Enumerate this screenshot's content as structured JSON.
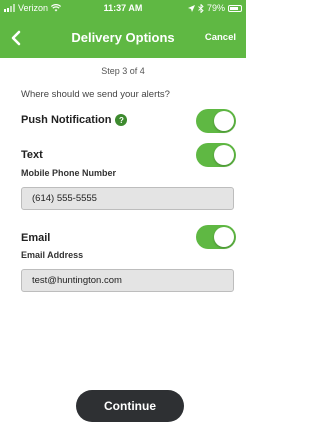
{
  "status_bar": {
    "carrier": "Verizon",
    "time": "11:37 AM",
    "battery": "79%"
  },
  "nav": {
    "title": "Delivery Options",
    "cancel_label": "Cancel",
    "back_icon": "chevron-left-icon"
  },
  "step_text": "Step 3 of 4",
  "prompt": "Where should we send your alerts?",
  "push": {
    "label": "Push Notification",
    "help": "?",
    "enabled": true
  },
  "text": {
    "label": "Text",
    "enabled": true,
    "field_label": "Mobile Phone Number",
    "field_value": "(614) 555-5555"
  },
  "email": {
    "label": "Email",
    "enabled": true,
    "field_label": "Email Address",
    "field_value": "test@huntington.com"
  },
  "continue_label": "Continue",
  "colors": {
    "brand_green": "#5fb843",
    "button_dark": "#2e3033"
  }
}
